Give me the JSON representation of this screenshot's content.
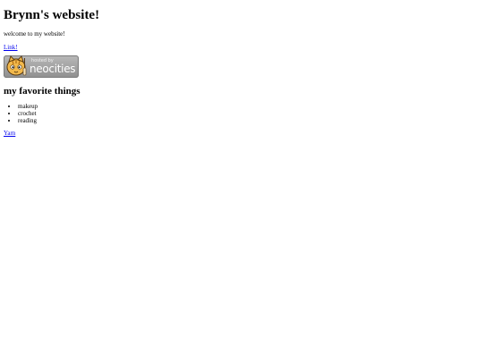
{
  "page": {
    "title": "Brynn's website!",
    "welcome": "welcome to my website!",
    "link_text": "Link!",
    "badge": {
      "small_text": "hosted by",
      "big_text": "neocities"
    },
    "favorites_heading": "my favorite things",
    "favorites": [
      "makeup",
      "crochet",
      "reading"
    ],
    "yarn_link": "Yarn"
  },
  "colors": {
    "link": "#0000ee",
    "badge_bg": "#a5a5a5"
  }
}
